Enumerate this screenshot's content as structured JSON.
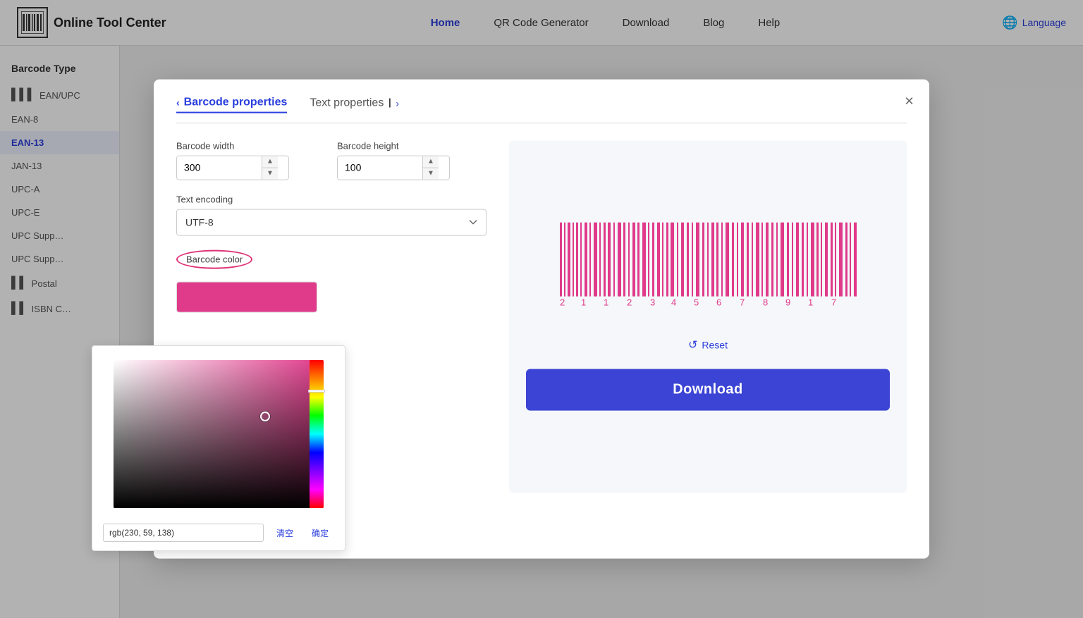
{
  "navbar": {
    "logo_text": "Online Tool Center",
    "links": [
      {
        "label": "Home",
        "active": true
      },
      {
        "label": "QR Code Generator",
        "active": false
      },
      {
        "label": "Download",
        "active": false
      },
      {
        "label": "Blog",
        "active": false
      },
      {
        "label": "Help",
        "active": false
      }
    ],
    "language_label": "Language"
  },
  "sidebar": {
    "title": "Barcode Type",
    "items": [
      {
        "label": "EAN/UPC",
        "icon": "barcode",
        "active": false
      },
      {
        "label": "EAN-8",
        "active": false
      },
      {
        "label": "EAN-13",
        "active": true
      },
      {
        "label": "JAN-13",
        "active": false
      },
      {
        "label": "UPC-A",
        "active": false
      },
      {
        "label": "UPC-E",
        "active": false
      },
      {
        "label": "UPC Supp…",
        "active": false
      },
      {
        "label": "UPC Supp…",
        "active": false
      },
      {
        "label": "Postal",
        "icon": "barcode",
        "active": false
      },
      {
        "label": "ISBN C…",
        "icon": "barcode",
        "active": false
      }
    ]
  },
  "modal": {
    "tab_barcode": "Barcode properties",
    "tab_text": "Text properties",
    "close_label": "×",
    "barcode_width_label": "Barcode width",
    "barcode_width_value": "300",
    "barcode_height_label": "Barcode height",
    "barcode_height_value": "100",
    "text_encoding_label": "Text encoding",
    "text_encoding_value": "UTF-8",
    "barcode_color_label": "Barcode color",
    "barcode_color_swatch": "#e03a8a",
    "reset_label": "Reset",
    "download_label": "Download"
  },
  "color_picker": {
    "hex_value": "rgb(230, 59, 138)",
    "clear_label": "清空",
    "confirm_label": "确定"
  },
  "barcode_preview": {
    "digits": [
      "2",
      "1",
      "1",
      "2",
      "3",
      "4",
      "5",
      "6",
      "7",
      "8",
      "9",
      "1",
      "7"
    ]
  }
}
